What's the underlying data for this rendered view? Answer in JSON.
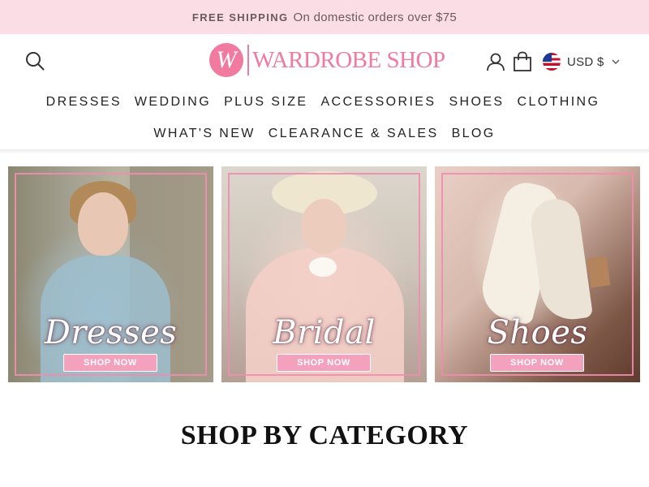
{
  "announcement": {
    "bold": "FREE SHIPPING",
    "text": "On domestic orders over $75"
  },
  "header": {
    "logo_letter": "W",
    "logo_text": "WARDROBE SHOP",
    "currency": "USD $",
    "icons": [
      "search-icon",
      "account-icon",
      "cart-icon",
      "us-flag-icon",
      "chevron-down-icon"
    ]
  },
  "nav": {
    "row1": [
      "DRESSES",
      "WEDDING",
      "PLUS SIZE",
      "ACCESSORIES",
      "SHOES",
      "CLOTHING"
    ],
    "row2": [
      "WHAT'S NEW",
      "CLEARANCE & SALES",
      "BLOG"
    ]
  },
  "banners": [
    {
      "title": "Dresses",
      "cta": "SHOP NOW"
    },
    {
      "title": "Bridal",
      "cta": "SHOP NOW"
    },
    {
      "title": "Shoes",
      "cta": "SHOP NOW"
    }
  ],
  "section": {
    "title": "SHOP BY CATEGORY"
  },
  "colors": {
    "announce_bg": "#fbdde6",
    "brand_pink": "#f07aa0",
    "cta_pink": "#f4a1bd"
  }
}
